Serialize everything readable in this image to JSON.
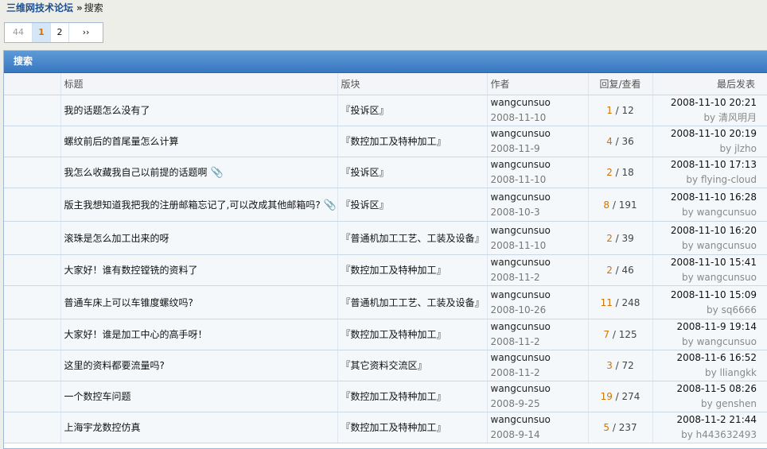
{
  "breadcrumb": {
    "forum": "三维网技术论坛",
    "sep": "»",
    "current": "搜索"
  },
  "pager": {
    "first": "44",
    "current": "1",
    "page2": "2",
    "next": "››"
  },
  "panel": {
    "title": "搜索"
  },
  "columns": {
    "title": "标题",
    "forum": "版块",
    "author": "作者",
    "replies": "回复/查看",
    "last": "最后发表"
  },
  "by_label": "by",
  "rows": [
    {
      "title": "我的话题怎么没有了",
      "attach": false,
      "forum": "『投诉区』",
      "author": "wangcunsuo",
      "date": "2008-11-10",
      "replies": "1",
      "views": "12",
      "last_time": "2008-11-10 20:21",
      "last_by": "清风明月"
    },
    {
      "title": "螺纹前后的首尾量怎么计算",
      "attach": false,
      "forum": "『数控加工及特种加工』",
      "author": "wangcunsuo",
      "date": "2008-11-9",
      "replies": "4",
      "views": "36",
      "last_time": "2008-11-10 20:19",
      "last_by": "jlzho"
    },
    {
      "title": "我怎么收藏我自己以前提的话题啊",
      "attach": true,
      "forum": "『投诉区』",
      "author": "wangcunsuo",
      "date": "2008-11-10",
      "replies": "2",
      "views": "18",
      "last_time": "2008-11-10 17:13",
      "last_by": "flying-cloud"
    },
    {
      "title": "版主我想知道我把我的注册邮箱忘记了,可以改成其他邮箱吗?",
      "attach": true,
      "forum": "『投诉区』",
      "author": "wangcunsuo",
      "date": "2008-10-3",
      "replies": "8",
      "views": "191",
      "last_time": "2008-11-10 16:28",
      "last_by": "wangcunsuo"
    },
    {
      "title": "滚珠是怎么加工出来的呀",
      "attach": false,
      "forum": "『普通机加工工艺、工装及设备』",
      "author": "wangcunsuo",
      "date": "2008-11-10",
      "replies": "2",
      "views": "39",
      "last_time": "2008-11-10 16:20",
      "last_by": "wangcunsuo"
    },
    {
      "title": "大家好！谁有数控镗铣的资料了",
      "attach": false,
      "forum": "『数控加工及特种加工』",
      "author": "wangcunsuo",
      "date": "2008-11-2",
      "replies": "2",
      "views": "46",
      "last_time": "2008-11-10 15:41",
      "last_by": "wangcunsuo"
    },
    {
      "title": "普通车床上可以车锥度螺纹吗?",
      "attach": false,
      "forum": "『普通机加工工艺、工装及设备』",
      "author": "wangcunsuo",
      "date": "2008-10-26",
      "replies": "11",
      "views": "248",
      "last_time": "2008-11-10 15:09",
      "last_by": "sq6666"
    },
    {
      "title": "大家好！谁是加工中心的高手呀！",
      "attach": false,
      "forum": "『数控加工及特种加工』",
      "author": "wangcunsuo",
      "date": "2008-11-2",
      "replies": "7",
      "views": "125",
      "last_time": "2008-11-9 19:14",
      "last_by": "wangcunsuo"
    },
    {
      "title": "这里的资料都要流量吗?",
      "attach": false,
      "forum": "『其它资料交流区』",
      "author": "wangcunsuo",
      "date": "2008-11-2",
      "replies": "3",
      "views": "72",
      "last_time": "2008-11-6 16:52",
      "last_by": "lliangkk"
    },
    {
      "title": "一个数控车问题",
      "attach": false,
      "forum": "『数控加工及特种加工』",
      "author": "wangcunsuo",
      "date": "2008-9-25",
      "replies": "19",
      "views": "274",
      "last_time": "2008-11-5 08:26",
      "last_by": "genshen"
    },
    {
      "title": "上海宇龙数控仿真",
      "attach": false,
      "forum": "『数控加工及特种加工』",
      "author": "wangcunsuo",
      "date": "2008-9-14",
      "replies": "5",
      "views": "237",
      "last_time": "2008-11-2 21:44",
      "last_by": "h443632493"
    }
  ]
}
